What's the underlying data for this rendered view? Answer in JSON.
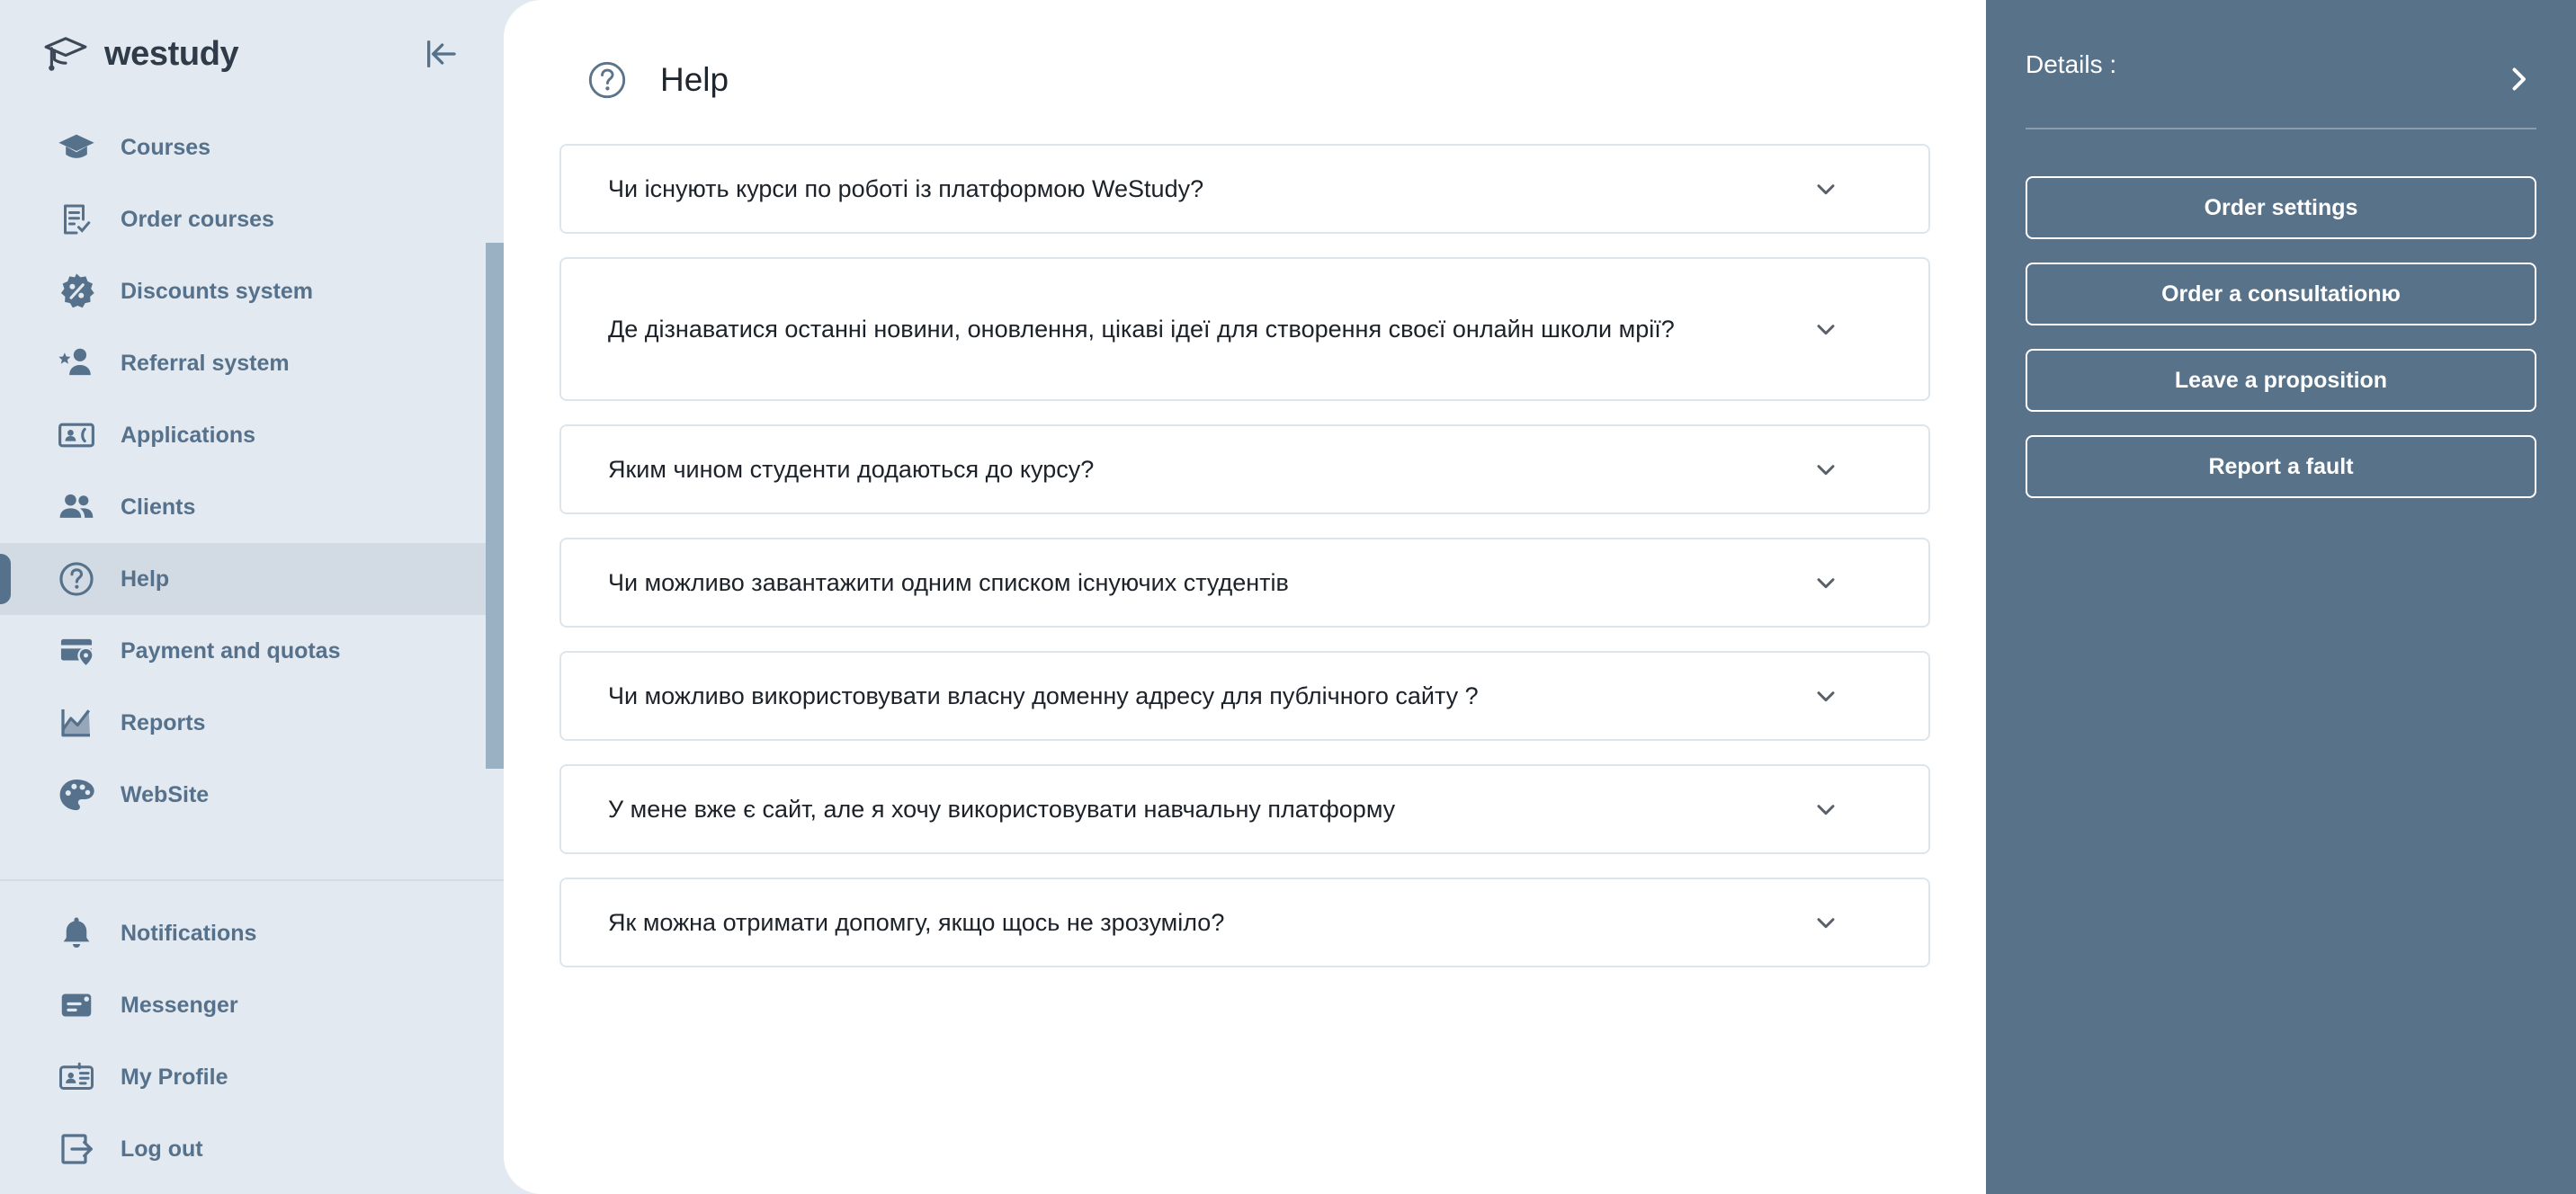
{
  "brand": {
    "name": "westudy",
    "logo_icon": "graduation-cap-icon",
    "collapse_icon": "collapse-sidebar-icon"
  },
  "sidebar": {
    "main_items": [
      {
        "label": "Courses",
        "icon": "graduation-cap-icon",
        "active": false
      },
      {
        "label": "Order courses",
        "icon": "receipt-check-icon",
        "active": false
      },
      {
        "label": "Discounts system",
        "icon": "discount-badge-icon",
        "active": false
      },
      {
        "label": "Referral system",
        "icon": "user-star-icon",
        "active": false
      },
      {
        "label": "Applications",
        "icon": "contact-card-icon",
        "active": false
      },
      {
        "label": "Clients",
        "icon": "users-icon",
        "active": false
      },
      {
        "label": "Help",
        "icon": "question-circle-icon",
        "active": true
      },
      {
        "label": "Payment and quotas",
        "icon": "card-pin-icon",
        "active": false
      },
      {
        "label": "Reports",
        "icon": "chart-line-icon",
        "active": false
      },
      {
        "label": "WebSite",
        "icon": "palette-icon",
        "active": false
      }
    ],
    "bottom_items": [
      {
        "label": "Notifications",
        "icon": "bell-icon",
        "active": false
      },
      {
        "label": "Messenger",
        "icon": "message-icon",
        "active": false
      },
      {
        "label": "My Profile",
        "icon": "id-card-icon",
        "active": false
      },
      {
        "label": "Log out",
        "icon": "logout-icon",
        "active": false
      }
    ]
  },
  "main": {
    "title": "Help",
    "title_icon": "question-circle-icon",
    "faq": [
      {
        "question": "Чи існують курси по роботі із платформою WeStudy?",
        "expanded": false,
        "two_line": false
      },
      {
        "question": "Де дізнаватися останні новини, оновлення, цікаві ідеї для створення своєї онлайн школи мрії?",
        "expanded": false,
        "two_line": true
      },
      {
        "question": "Яким чином студенти додаються до курсу?",
        "expanded": false,
        "two_line": false
      },
      {
        "question": "Чи можливо завантажити одним списком існуючих студентів",
        "expanded": false,
        "two_line": false
      },
      {
        "question": "Чи можливо використовувати власну доменну адресу для публічного сайту ?",
        "expanded": false,
        "two_line": false
      },
      {
        "question": "У мене вже є сайт, але я хочу використовувати навчальну платформу",
        "expanded": false,
        "two_line": false
      },
      {
        "question": "Як можна отримати допомгу, якщо щось не зрозуміло?",
        "expanded": false,
        "two_line": false
      }
    ],
    "chevron_icon": "chevron-down-icon"
  },
  "right_panel": {
    "details_label": "Details :",
    "details_arrow_icon": "chevron-right-icon",
    "buttons": [
      {
        "label": "Order settings"
      },
      {
        "label": "Order a consultationю"
      },
      {
        "label": "Leave a proposition"
      },
      {
        "label": "Report a fault"
      }
    ]
  },
  "colors": {
    "sidebar_bg": "#e2e9f0",
    "sidebar_active_bg": "#d2dbe4",
    "accent": "#56718b",
    "right_panel_bg": "#577289",
    "main_bg": "#ffffff",
    "card_border": "#dde5ec",
    "scrollbar_thumb": "#9ab0c3"
  }
}
